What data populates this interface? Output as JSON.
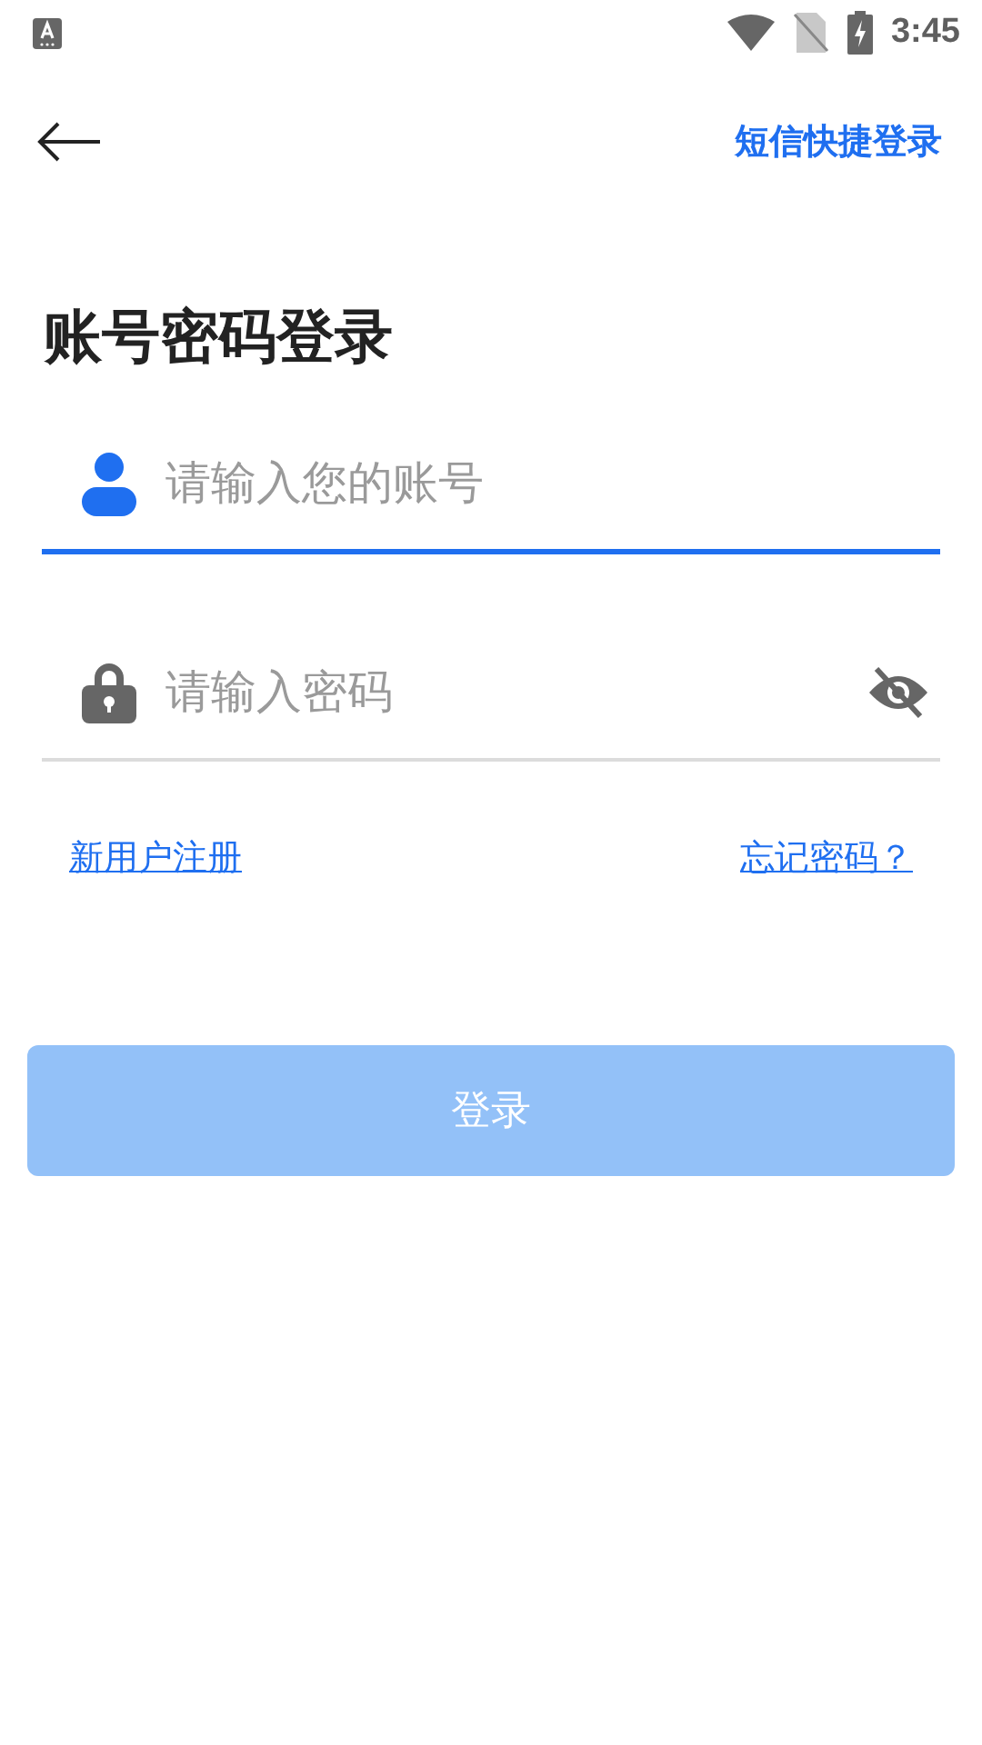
{
  "status_bar": {
    "time": "3:45"
  },
  "header": {
    "link": "短信快捷登录"
  },
  "title": "账号密码登录",
  "fields": [
    {
      "kind": "account",
      "placeholder": "请输入您的账号",
      "focused": true
    },
    {
      "kind": "password",
      "placeholder": "请输入密码",
      "focused": false,
      "show_password": false
    }
  ],
  "links": [
    "新用户注册",
    "忘记密码？"
  ],
  "login_button": {
    "label": "登录",
    "disabled": true
  }
}
